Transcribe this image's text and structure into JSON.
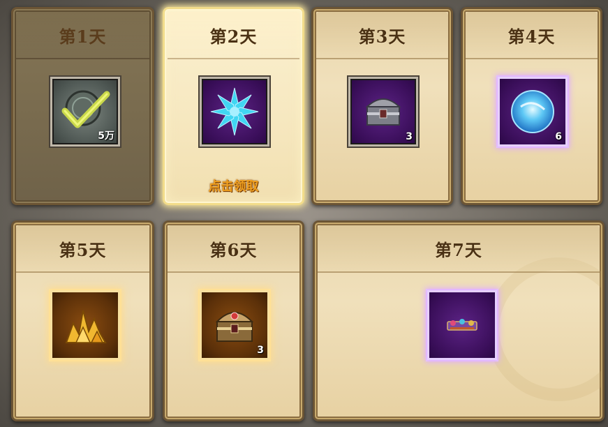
{
  "days": [
    {
      "label": "第1天",
      "quantity": "5万",
      "state": "claimed",
      "icon": "check-coin-icon"
    },
    {
      "label": "第2天",
      "quantity": "",
      "state": "claimable",
      "icon": "blue-crystal-flower-icon",
      "claim_text": "点击领取"
    },
    {
      "label": "第3天",
      "quantity": "3",
      "icon": "silver-chest-icon"
    },
    {
      "label": "第4天",
      "quantity": "6",
      "icon": "blue-orb-icon"
    },
    {
      "label": "第5天",
      "quantity": "",
      "icon": "gold-ore-icon"
    },
    {
      "label": "第6天",
      "quantity": "3",
      "icon": "gold-chest-icon"
    },
    {
      "label": "第7天",
      "quantity": "",
      "icon": "costume-bundle-icon"
    }
  ]
}
